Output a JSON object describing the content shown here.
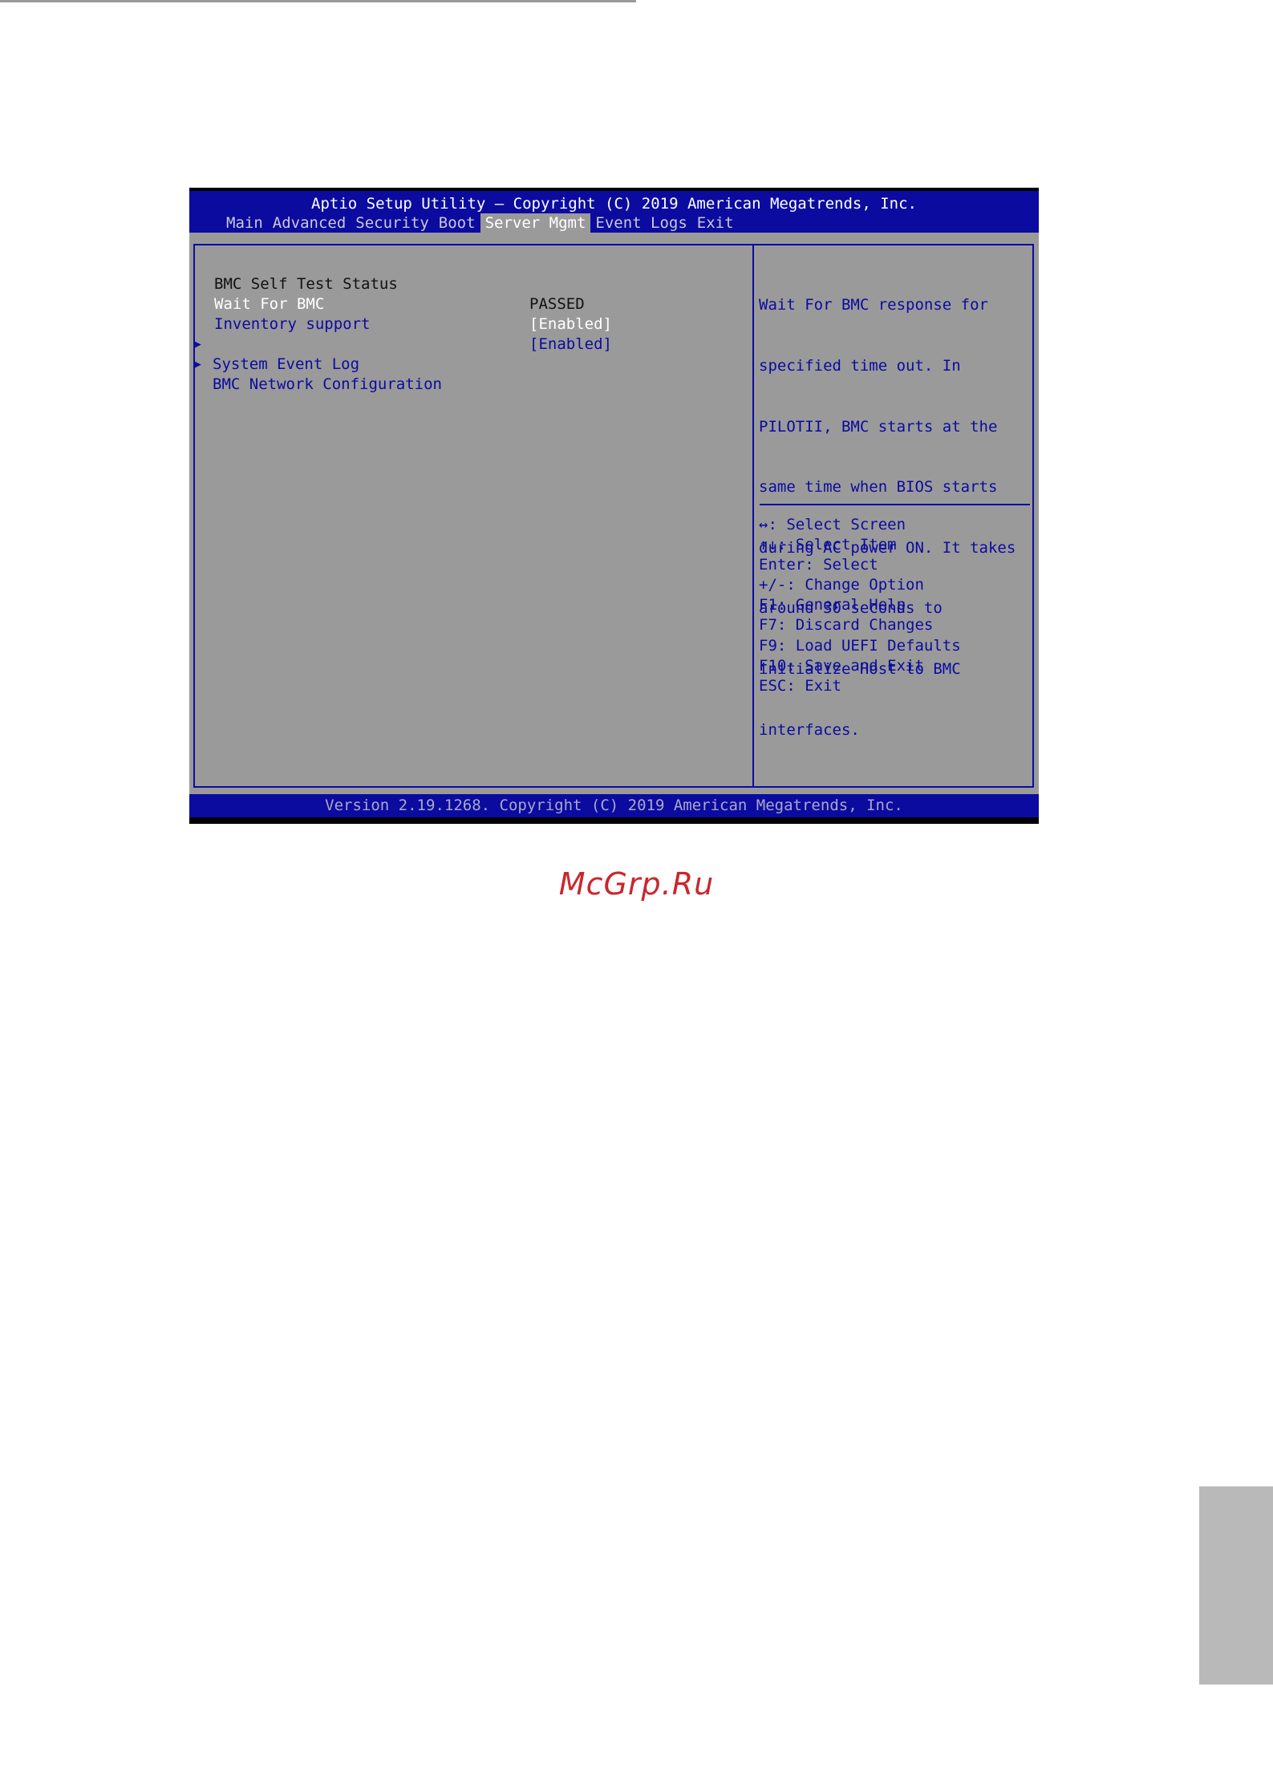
{
  "bios": {
    "title": "Aptio Setup Utility – Copyright (C) 2019 American Megatrends, Inc.",
    "tabs": [
      {
        "label": "Main"
      },
      {
        "label": "Advanced"
      },
      {
        "label": "Security"
      },
      {
        "label": "Boot"
      },
      {
        "label": "Server Mgmt",
        "active": true
      },
      {
        "label": "Event Logs"
      },
      {
        "label": "Exit"
      }
    ],
    "items": [
      {
        "label": "BMC Self Test Status",
        "value": "PASSED"
      },
      {
        "label": "Wait For BMC",
        "value": "[Enabled]",
        "selected": true
      },
      {
        "label": "Inventory support",
        "value": "[Enabled]"
      },
      {
        "label": "System Event Log",
        "submenu_marker": "▶"
      },
      {
        "label": "BMC Network Configuration",
        "submenu_marker": "▶"
      }
    ],
    "help_text": "Wait For BMC response for specified time out. In PILOTII, BMC starts at the same time when BIOS starts during AC power ON. It takes around 30 seconds to initialize Host to BMC interfaces.",
    "help_lines": [
      "Wait For BMC response for",
      "specified time out. In",
      "PILOTII, BMC starts at the",
      "same time when BIOS starts",
      "during AC power ON. It takes",
      "around 30 seconds to",
      "initialize Host to BMC",
      "interfaces."
    ],
    "key_help": [
      "↔: Select Screen",
      "↑↓: Select Item",
      "Enter: Select",
      "+/-: Change Option",
      "F1: General Help",
      "F7: Discard Changes",
      "F9: Load UEFI Defaults",
      "F10: Save and Exit",
      "ESC: Exit"
    ],
    "footer": "Version 2.19.1268. Copyright (C) 2019 American Megatrends, Inc.",
    "colors": {
      "header_blue": "#0b0ba0",
      "body_gray": "#9a9a9a",
      "selected_text": "#ffffff"
    }
  },
  "watermark": {
    "text": "McGrp.Ru",
    "color": "#c9272d"
  }
}
